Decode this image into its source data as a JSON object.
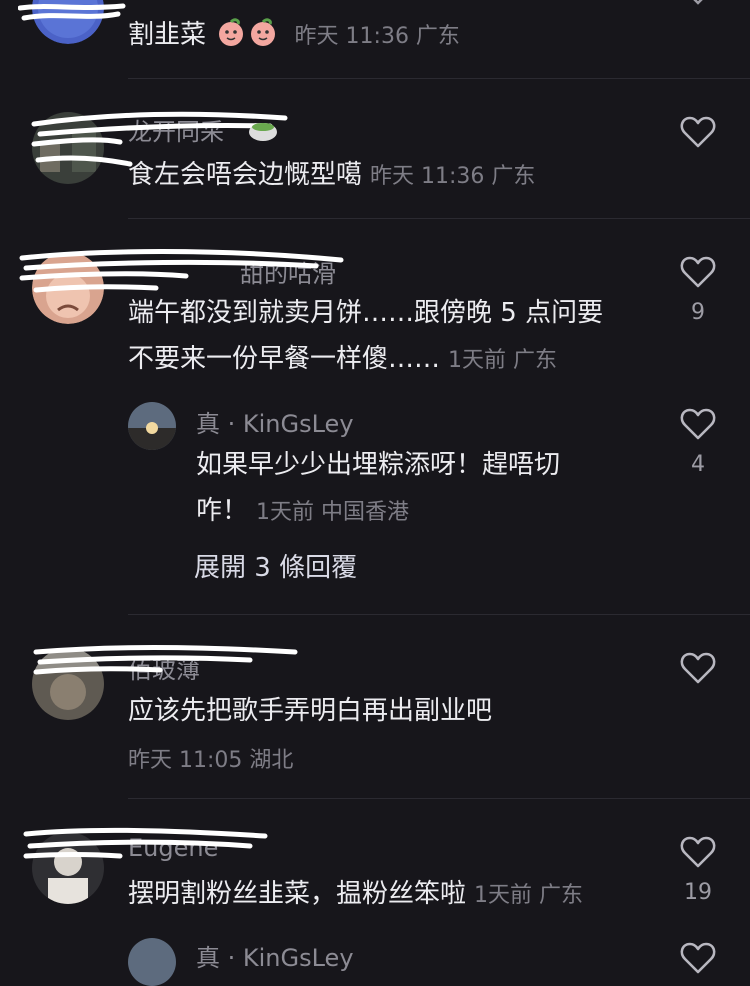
{
  "comments": [
    {
      "text": "割韭菜",
      "meta": "昨天 11:36 广东",
      "emoji_icons": [
        "peach-face-icon",
        "peach-face-icon"
      ]
    },
    {
      "username": "龙开同采",
      "text": "食左会唔会边慨型噶",
      "meta": "昨天 11:36 广东"
    },
    {
      "username": "甜的咕滑",
      "text_line1": "端午都没到就卖月饼……跟傍晚 5 点问要",
      "text_line2": "不要来一份早餐一样傻……",
      "meta": "1天前 广东",
      "likes": "9",
      "reply": {
        "username": "真 · KinGsLey",
        "text_line1": "如果早少少出埋粽添呀！趕唔切",
        "text_line2": "咋！",
        "meta": "1天前 中国香港",
        "likes": "4"
      },
      "expand_label": "展開 3 條回覆"
    },
    {
      "username": "佰玻薄",
      "text": "应该先把歌手弄明白再出副业吧",
      "meta": "昨天 11:05 湖北"
    },
    {
      "username": "Eugene",
      "text": "摆明割粉丝韭菜，揾粉丝笨啦",
      "meta": "1天前 广东",
      "likes": "19"
    },
    {
      "username": "真 · KinGsLey"
    }
  ],
  "colors": {
    "background": "#17161b",
    "text": "#ececf0",
    "meta": "#7e7d86",
    "divider": "#2b2a31"
  }
}
